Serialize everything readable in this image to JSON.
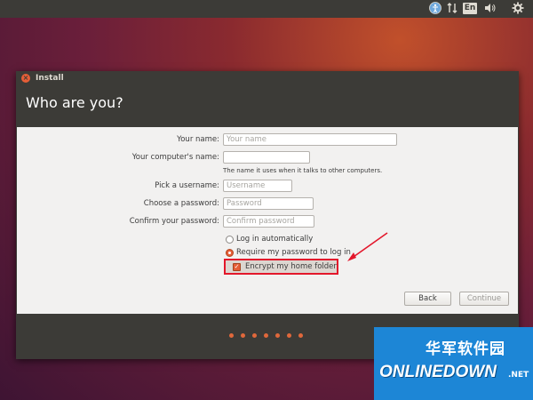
{
  "topbar": {
    "icons": [
      "accessibility-icon",
      "network-arrows-icon",
      "keyboard-layout-icon",
      "volume-icon",
      "settings-gear-icon"
    ],
    "language": "En"
  },
  "window": {
    "title": "Install",
    "heading": "Who are you?"
  },
  "form": {
    "name_label": "Your name:",
    "name_placeholder": "Your name",
    "name_value": "",
    "computer_label": "Your computer's name:",
    "computer_value": "",
    "computer_hint": "The name it uses when it talks to other computers.",
    "username_label": "Pick a username:",
    "username_placeholder": "Username",
    "password_label": "Choose a password:",
    "password_placeholder": "Password",
    "confirm_label": "Confirm your password:",
    "confirm_placeholder": "Confirm password",
    "login_auto_label": "Log in automatically",
    "login_require_label": "Require my password to log in",
    "encrypt_label": "Encrypt my home folder",
    "login_mode": "require",
    "encrypt_checked": true
  },
  "buttons": {
    "back": "Back",
    "continue": "Continue"
  },
  "progress": {
    "dots": 7
  },
  "watermark": {
    "cn": "华军软件园",
    "brand": "ONLINEDOWN",
    "suffix": ".NET"
  },
  "colors": {
    "accent": "#e65e37",
    "highlight": "#e3172b",
    "panel": "#3c3b37",
    "content": "#f2f1f0"
  }
}
